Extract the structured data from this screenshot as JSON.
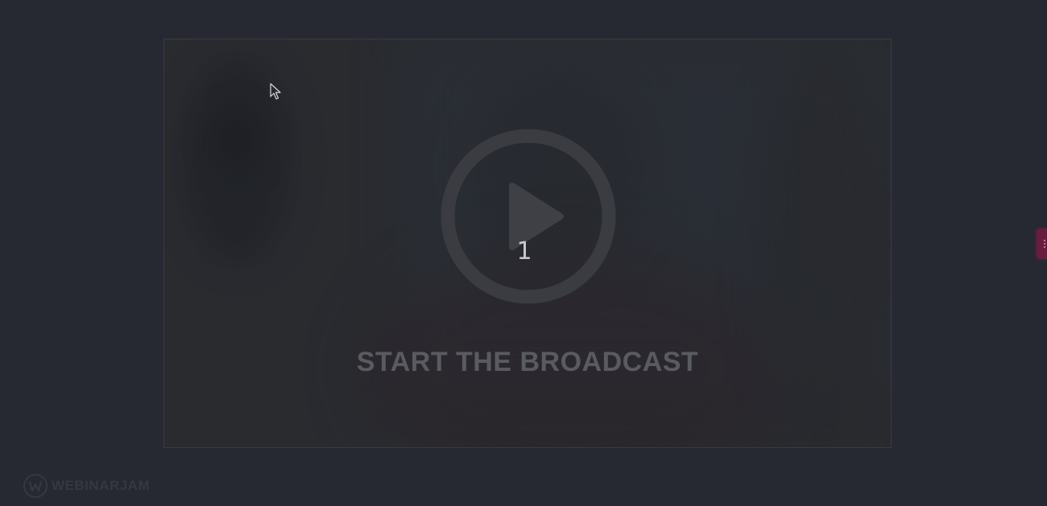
{
  "player": {
    "countdown": "1",
    "start_label": "START THE BROADCAST"
  },
  "brand": {
    "name": "WEBINARJAM",
    "icon": "webinarjam-logo-icon"
  },
  "side_panel": {
    "icon": "grip-icon",
    "accent_color": "#6a1c3f"
  },
  "colors": {
    "background": "#262931",
    "video_frame": "#2c2d31",
    "label_text": "#5a5b60"
  }
}
